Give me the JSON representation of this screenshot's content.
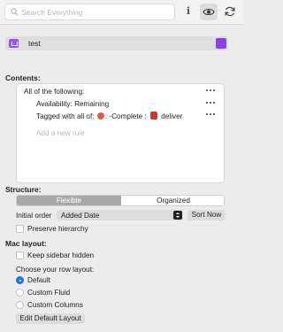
{
  "toolbar": {
    "search_placeholder": "Search Everything",
    "info_label": "i",
    "icons": [
      "search-icon",
      "info-icon",
      "eye-icon",
      "refresh-icon"
    ]
  },
  "tag": {
    "name": "test",
    "color": "#8b43e0"
  },
  "contents": {
    "title": "Contents:",
    "group_label": "All of the following:",
    "rules": [
      {
        "text": "Availability: Remaining"
      },
      {
        "prefix": "Tagged with all of:",
        "tag1": ": -Complete :",
        "tag2": "deliver"
      }
    ],
    "add_rule_placeholder": "Add a new rule"
  },
  "structure": {
    "title": "Structure:",
    "segments": [
      "Flexible",
      "Organized"
    ],
    "selected_segment": "Flexible",
    "initial_order_label": "Initial order",
    "initial_order_value": "Added Date",
    "sort_now_label": "Sort Now",
    "preserve_hierarchy_label": "Preserve hierarchy",
    "preserve_hierarchy_checked": false
  },
  "mac_layout": {
    "title": "Mac layout:",
    "keep_sidebar_hidden_label": "Keep sidebar hidden",
    "keep_sidebar_hidden_checked": false,
    "row_layout_prompt": "Choose your row layout:",
    "options": [
      "Default",
      "Custom Fluid",
      "Custom Columns"
    ],
    "selected_option": "Default",
    "edit_button_label": "Edit Default Layout"
  },
  "colors": {
    "accent": "#1e74e8",
    "tag_purple": "#8b43e0"
  }
}
